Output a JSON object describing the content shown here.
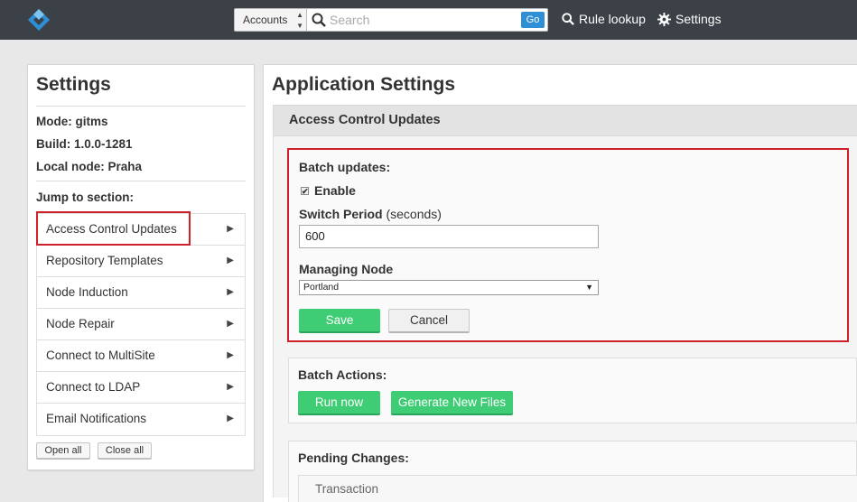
{
  "topbar": {
    "scope_select": "Accounts",
    "search_placeholder": "Search",
    "go_label": "Go",
    "rule_lookup": "Rule lookup",
    "settings": "Settings"
  },
  "sidebar": {
    "title": "Settings",
    "mode": "Mode: gitms",
    "build": "Build: 1.0.0-1281",
    "local_node": "Local node: Praha",
    "jump_label": "Jump to section:",
    "items": [
      {
        "label": "Access Control Updates"
      },
      {
        "label": "Repository Templates"
      },
      {
        "label": "Node Induction"
      },
      {
        "label": "Node Repair"
      },
      {
        "label": "Connect to MultiSite"
      },
      {
        "label": "Connect to LDAP"
      },
      {
        "label": "Email Notifications"
      }
    ],
    "open_all": "Open all",
    "close_all": "Close all"
  },
  "main": {
    "title": "Application Settings",
    "section_header": "Access Control Updates",
    "batch_updates": {
      "heading": "Batch updates:",
      "enable_label": "Enable",
      "enable_checked": true,
      "switch_period_label": "Switch Period",
      "switch_period_unit": "(seconds)",
      "switch_period_value": "600",
      "managing_node_label": "Managing Node",
      "managing_node_value": "Portland",
      "save": "Save",
      "cancel": "Cancel"
    },
    "batch_actions": {
      "heading": "Batch Actions:",
      "run_now": "Run now",
      "generate": "Generate New Files"
    },
    "pending": {
      "heading": "Pending Changes:",
      "column": "Transaction"
    }
  },
  "colors": {
    "topbar": "#3c4047",
    "accent_blue": "#2f8fd4",
    "green": "#3ecc74",
    "highlight_red": "#d0202a"
  }
}
